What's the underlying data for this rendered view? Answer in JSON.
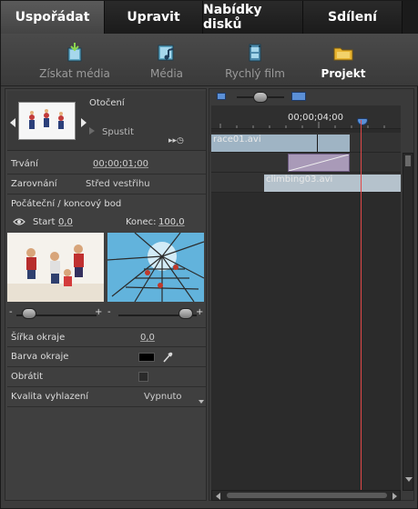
{
  "tabs": [
    {
      "label": "Uspořádat",
      "active": true
    },
    {
      "label": "Upravit",
      "active": false
    },
    {
      "label": "Nabídky disků",
      "active": false
    },
    {
      "label": "Sdílení",
      "active": false
    }
  ],
  "toolbar": {
    "items": [
      {
        "label": "Získat média",
        "icon": "get-media-icon",
        "active": false
      },
      {
        "label": "Média",
        "icon": "media-icon",
        "active": false
      },
      {
        "label": "Rychlý film",
        "icon": "quick-movie-icon",
        "active": false
      },
      {
        "label": "Projekt",
        "icon": "project-folder-icon",
        "active": true
      }
    ]
  },
  "left_panel": {
    "transition_name": "Otočení",
    "play_label": "Spustit",
    "properties": {
      "duration_label": "Trvání",
      "duration_value": "00;00;01;00",
      "alignment_label": "Zarovnání",
      "alignment_value": "Střed vestřihu",
      "start_end_label": "Počáteční / koncový bod",
      "start_label": "Start",
      "start_value": "0,0",
      "end_label": "Konec:",
      "end_value": "100,0",
      "slider_minus": "-",
      "slider_plus": "+",
      "border_width_label": "Šířka okraje",
      "border_width_value": "0,0",
      "border_color_label": "Barva okraje",
      "reverse_label": "Obrátit",
      "anti_alias_label": "Kvalita vyhlazení",
      "anti_alias_value": "Vypnuto"
    }
  },
  "timeline": {
    "timecode": "00;00;04;00",
    "clips": [
      {
        "name": "race01.avi",
        "track": 1
      },
      {
        "name": "",
        "track": 2
      },
      {
        "name": "climbing03.avi",
        "track": 3
      }
    ]
  },
  "colors": {
    "active_tab": "#4a4a4a",
    "clip_blue": "#9fb4c4",
    "transition_purple": "#a99ab8",
    "playhead": "#e04848",
    "marker_blue": "#5b8fd6"
  }
}
